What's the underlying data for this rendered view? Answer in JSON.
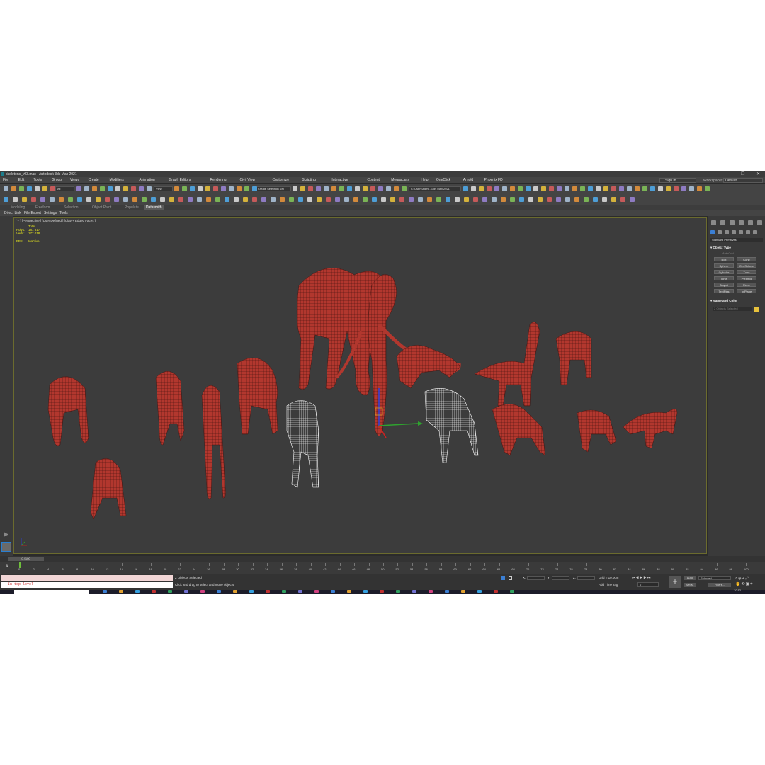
{
  "window": {
    "title": "skeletons_v03.max - Autodesk 3ds Max 2021",
    "controls": {
      "minimize": "–",
      "maximize": "❐",
      "close": "✕"
    }
  },
  "menu": [
    "File",
    "Edit",
    "Tools",
    "Group",
    "Views",
    "Create",
    "Modifiers",
    "Animation",
    "Graph Editors",
    "Rendering",
    "Civil View",
    "Customize",
    "Scripting",
    "Interactive",
    "Content",
    "Megascans",
    "Help",
    "OneClick",
    "Arnold",
    "Phoenix FD"
  ],
  "account": {
    "sign_in": "Sign In",
    "workspaces_label": "Workspaces:",
    "workspace": "Default"
  },
  "toolbar": {
    "filter": "All",
    "view": "View",
    "selection_set": "Create Selection Set",
    "path": "C:\\Users\\admi...\\3ds Max 2021",
    "icon_names": [
      "undo-icon",
      "redo-icon",
      "link-icon",
      "unlink-icon",
      "bind-icon",
      "select-icon",
      "select-by-name-icon",
      "region-select-icon",
      "window-crossing-icon",
      "move-icon",
      "rotate-icon",
      "scale-icon",
      "snap-icon",
      "angle-snap-icon",
      "percent-snap-icon",
      "spinner-snap-icon",
      "mirror-icon",
      "align-icon",
      "layer-icon",
      "curve-editor-icon",
      "schematic-icon",
      "material-editor-icon",
      "render-setup-icon",
      "render-icon"
    ]
  },
  "ribbon": {
    "tabs": [
      "Modeling",
      "Freeform",
      "Selection",
      "Object Paint",
      "Populate",
      "Datasmith"
    ],
    "active_tab": "Datasmith",
    "sub_items": [
      "Direct Link",
      "File Export",
      "Settings",
      "Tools"
    ]
  },
  "viewport": {
    "label": "[ + ] [Perspective ] [User Defined ] [Clay + Edged Faces ]",
    "stats": {
      "total_label": "Total",
      "polys_label": "Polys:",
      "polys": "181 317",
      "verts_label": "Verts:",
      "verts": "177 018",
      "fps_label": "FPS:",
      "fps": "Inactive"
    },
    "colors": {
      "mesh": "#b2372e",
      "wire": "#3a0f0c",
      "selected": "#ffffff",
      "bg": "#3c3c3c"
    }
  },
  "command_panel": {
    "category": "Standard Primitives",
    "object_type_header": "Object Type",
    "autogrid": "AutoGrid",
    "buttons": [
      "Box",
      "Cone",
      "Sphere",
      "GeoSphere",
      "Cylinder",
      "Tube",
      "Torus",
      "Pyramid",
      "Teapot",
      "Plane",
      "TextPlus",
      "hyPlane"
    ],
    "name_color_header": "Name and Color",
    "name_value": "2 Objects Selected",
    "swatch_color": "#e8c23c"
  },
  "timeline": {
    "slider": "0 / 100",
    "ticks": [
      0,
      2,
      4,
      6,
      8,
      10,
      12,
      14,
      16,
      18,
      20,
      22,
      24,
      26,
      28,
      30,
      32,
      34,
      36,
      38,
      40,
      42,
      44,
      46,
      48,
      50,
      52,
      54,
      56,
      58,
      60,
      62,
      64,
      66,
      68,
      70,
      72,
      74,
      76,
      78,
      80,
      82,
      84,
      86,
      88,
      90,
      92,
      94,
      96,
      98,
      100
    ]
  },
  "status": {
    "maxscript": "- In top-level",
    "selected": "2 Objects Selected",
    "prompt": "Click and drag to select and move objects",
    "x_label": "X:",
    "y_label": "Y:",
    "z_label": "Z:",
    "grid": "Grid = 10,0cm",
    "add_time_tag": "Add Time Tag",
    "auto": "Auto",
    "set_key": "Set K.",
    "selected_dd": "Selected",
    "filters": "Filters...",
    "frame": "0",
    "clock": "10:12"
  }
}
